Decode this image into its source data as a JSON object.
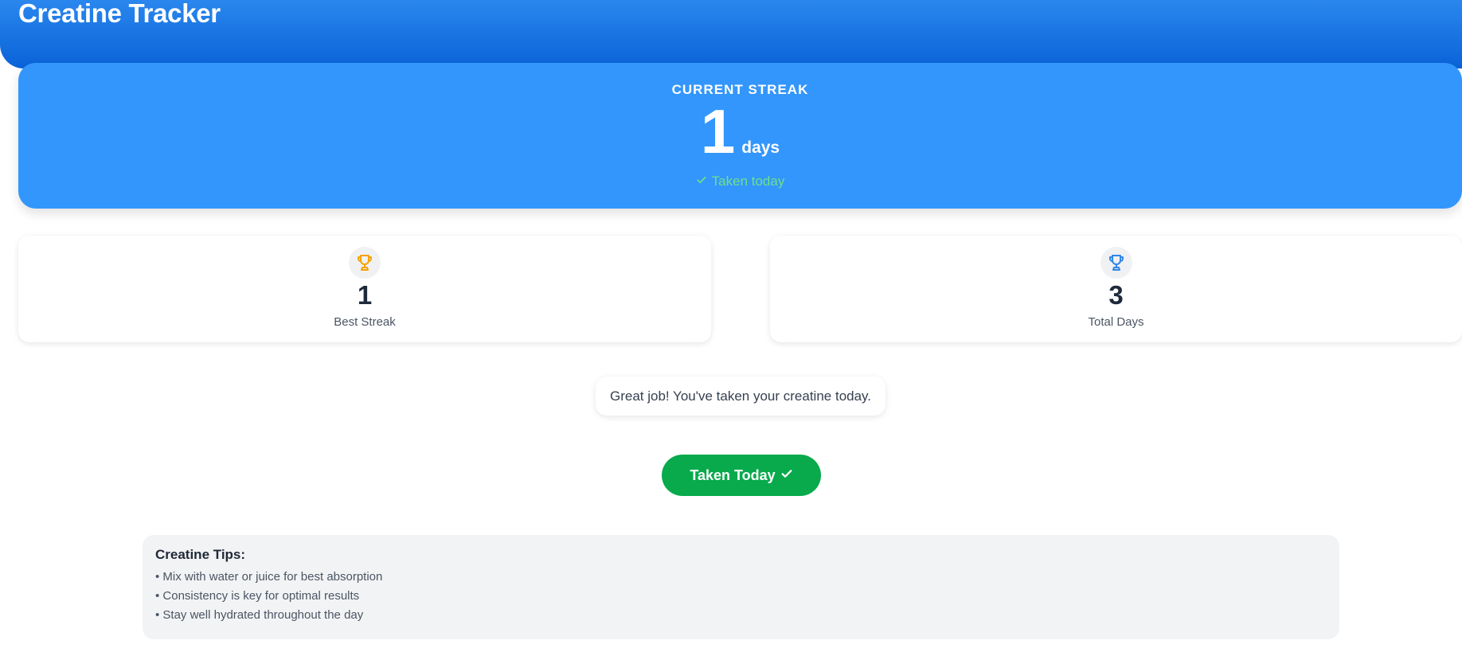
{
  "app": {
    "title": "Creatine Tracker"
  },
  "streak": {
    "label": "CURRENT STREAK",
    "value": "1",
    "unit": "days",
    "status": "Taken today",
    "status_icon": "check-icon"
  },
  "stats": [
    {
      "value": "1",
      "label": "Best Streak",
      "icon": "trophy-icon",
      "icon_color": "#f5a300"
    },
    {
      "value": "3",
      "label": "Total Days",
      "icon": "trophy-icon",
      "icon_color": "#2f86ea"
    }
  ],
  "message": {
    "text": "Great job! You've taken your creatine today."
  },
  "action": {
    "label": "Taken Today",
    "icon": "check-icon",
    "color": "#08aa4b"
  },
  "tips": {
    "title": "Creatine Tips:",
    "items": [
      "• Mix with water or juice for best absorption",
      "• Consistency is key for optimal results",
      "• Stay well hydrated throughout the day"
    ]
  },
  "colors": {
    "header": "#0a63d8",
    "streak_card": "#3396fc",
    "status_text": "#6ee08a"
  }
}
